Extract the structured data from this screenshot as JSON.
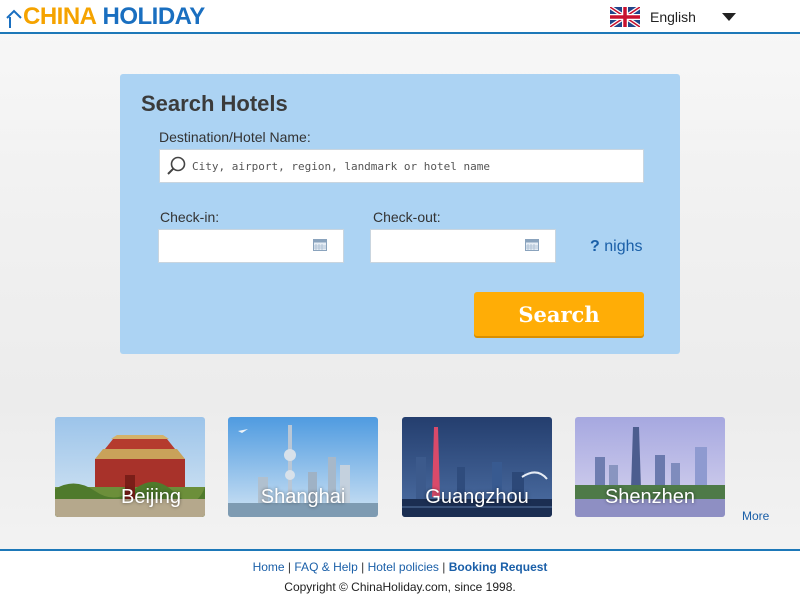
{
  "header": {
    "logo_part1": "CHINA",
    "logo_part2": "HOLIDAY",
    "language": "English",
    "flag_icon": "uk-flag-icon"
  },
  "search": {
    "title": "Search Hotels",
    "destination_label": "Destination/Hotel Name:",
    "destination_placeholder": "City, airport, region, landmark or hotel name",
    "destination_value": "",
    "checkin_label": "Check-in:",
    "checkin_value": "",
    "checkout_label": "Check-out:",
    "checkout_value": "",
    "nights_count": "?",
    "nights_label": "nighs",
    "button_label": "Search"
  },
  "cities": [
    {
      "name": "Beijing"
    },
    {
      "name": "Shanghai"
    },
    {
      "name": "Guangzhou"
    },
    {
      "name": "Shenzhen"
    }
  ],
  "more_label": "More",
  "footer": {
    "links": [
      {
        "label": "Home"
      },
      {
        "label": "FAQ & Help"
      },
      {
        "label": "Hotel policies"
      },
      {
        "label": "Booking Request"
      }
    ],
    "separator": "|",
    "copyright": "Copyright © ChinaHoliday.com, since 1998."
  },
  "colors": {
    "accent_blue": "#1d78b8",
    "panel_bg": "#acd3f3",
    "search_button": "#ffad06",
    "link": "#1a5fa8",
    "logo_orange": "#f5a300",
    "logo_blue": "#1a6fc0"
  }
}
